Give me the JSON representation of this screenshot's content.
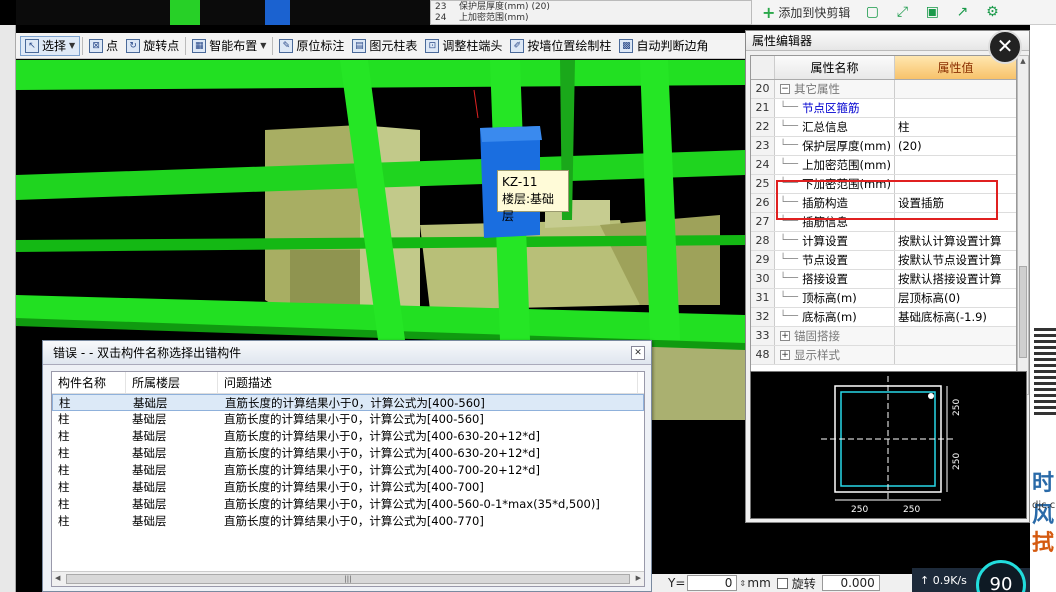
{
  "top_strip": {
    "rows": [
      {
        "no": "23",
        "text": "保护层厚度(mm)",
        "value": "(20)"
      },
      {
        "no": "24",
        "text": "上加密范围(mm)",
        "value": ""
      }
    ]
  },
  "clipboard": {
    "add_label": "添加到快剪辑"
  },
  "toolbar": {
    "select": "选择",
    "point": "点",
    "rotate_point": "旋转点",
    "smart_layout": "智能布置",
    "origin_label": "原位标注",
    "element_column_table": "图元柱表",
    "adjust_column_end": "调整柱端头",
    "draw_by_wall": "按墙位置绘制柱",
    "auto_corner": "自动判断边角"
  },
  "tooltip": {
    "line1": "KZ-11",
    "line2": "楼层:基础层"
  },
  "property_editor": {
    "title": "属性编辑器",
    "col_name": "属性名称",
    "col_value": "属性值",
    "rows": [
      {
        "no": "20",
        "name": "其它属性",
        "value": "",
        "type": "group"
      },
      {
        "no": "21",
        "name": "节点区箍筋",
        "value": "",
        "type": "blue"
      },
      {
        "no": "22",
        "name": "汇总信息",
        "value": "柱",
        "type": "item"
      },
      {
        "no": "23",
        "name": "保护层厚度(mm)",
        "value": "(20)",
        "type": "item"
      },
      {
        "no": "24",
        "name": "上加密范围(mm)",
        "value": "",
        "type": "item"
      },
      {
        "no": "25",
        "name": "下加密范围(mm)",
        "value": "",
        "type": "item"
      },
      {
        "no": "26",
        "name": "插筋构造",
        "value": "设置插筋",
        "type": "item"
      },
      {
        "no": "27",
        "name": "插筋信息",
        "value": "",
        "type": "item"
      },
      {
        "no": "28",
        "name": "计算设置",
        "value": "按默认计算设置计算",
        "type": "item"
      },
      {
        "no": "29",
        "name": "节点设置",
        "value": "按默认节点设置计算",
        "type": "item"
      },
      {
        "no": "30",
        "name": "搭接设置",
        "value": "按默认搭接设置计算",
        "type": "item"
      },
      {
        "no": "31",
        "name": "顶标高(m)",
        "value": "层顶标高(0)",
        "type": "item"
      },
      {
        "no": "32",
        "name": "底标高(m)",
        "value": "基础底标高(-1.9)",
        "type": "item"
      },
      {
        "no": "33",
        "name": "锚固搭接",
        "value": "",
        "type": "group-collapsed"
      },
      {
        "no": "48",
        "name": "显示样式",
        "value": "",
        "type": "group-collapsed"
      }
    ],
    "preview": {
      "dim_v1": "250",
      "dim_v2": "250",
      "dim_h1": "250",
      "dim_h2": "250"
    }
  },
  "error_dialog": {
    "title": "错误 - - 双击构件名称选择出错构件",
    "headers": [
      "构件名称",
      "所属楼层",
      "问题描述"
    ],
    "rows": [
      {
        "name": "柱",
        "floor": "基础层",
        "desc": "直筋长度的计算结果小于0，计算公式为[400-560]"
      },
      {
        "name": "柱",
        "floor": "基础层",
        "desc": "直筋长度的计算结果小于0，计算公式为[400-560]"
      },
      {
        "name": "柱",
        "floor": "基础层",
        "desc": "直筋长度的计算结果小于0，计算公式为[400-630-20+12*d]"
      },
      {
        "name": "柱",
        "floor": "基础层",
        "desc": "直筋长度的计算结果小于0，计算公式为[400-630-20+12*d]"
      },
      {
        "name": "柱",
        "floor": "基础层",
        "desc": "直筋长度的计算结果小于0，计算公式为[400-700-20+12*d]"
      },
      {
        "name": "柱",
        "floor": "基础层",
        "desc": "直筋长度的计算结果小于0，计算公式为[400-700]"
      },
      {
        "name": "柱",
        "floor": "基础层",
        "desc": "直筋长度的计算结果小于0，计算公式为[400-560-0-1*max(35*d,500)]"
      },
      {
        "name": "柱",
        "floor": "基础层",
        "desc": "直筋长度的计算结果小于0，计算公式为[400-770]"
      }
    ]
  },
  "status_bar": {
    "unit": "mm",
    "y_label": "Y=",
    "y_value": "0",
    "rotate_label": "旋转",
    "rotate_value": "0.000"
  },
  "net": {
    "speed": "0.9K/s",
    "gauge": "90"
  },
  "right_frag": {
    "t1": "时风",
    "t2": "djc.c",
    "t3": "拭"
  },
  "colors": {
    "beam_green": "#1edc1e",
    "column_blue": "#1a6ee0",
    "foundation_olive": "#b0b870",
    "header_value_orange": "#f7c26a",
    "highlight_red": "#e02020"
  }
}
